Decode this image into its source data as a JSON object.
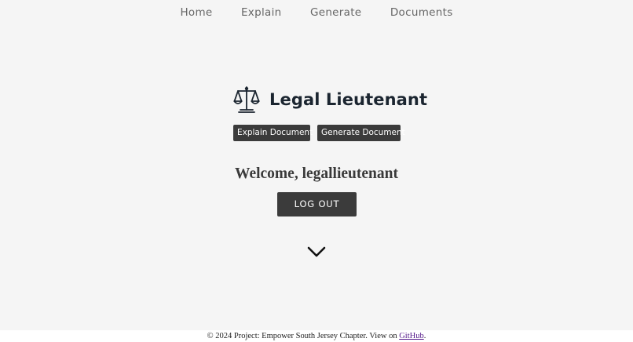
{
  "nav": {
    "items": [
      {
        "label": "Home"
      },
      {
        "label": "Explain"
      },
      {
        "label": "Generate"
      },
      {
        "label": "Documents"
      }
    ]
  },
  "brand": {
    "title": "Legal Lieutenant",
    "icon": "scales-of-justice-icon"
  },
  "actions": {
    "explain_label": "Explain Document",
    "generate_label": "Generate Document"
  },
  "welcome": {
    "text": "Welcome, legallieutenant"
  },
  "logout": {
    "label": "LOG OUT"
  },
  "scroll": {
    "icon": "chevron-down-icon"
  },
  "footer": {
    "prefix": "© 2024 Project: Empower South Jersey Chapter. View on ",
    "link_label": "GitHub",
    "suffix": "."
  },
  "colors": {
    "background": "#f5f5f5",
    "button": "#3b3b3b",
    "brand_text": "#1b2530",
    "link": "#551a8b"
  }
}
